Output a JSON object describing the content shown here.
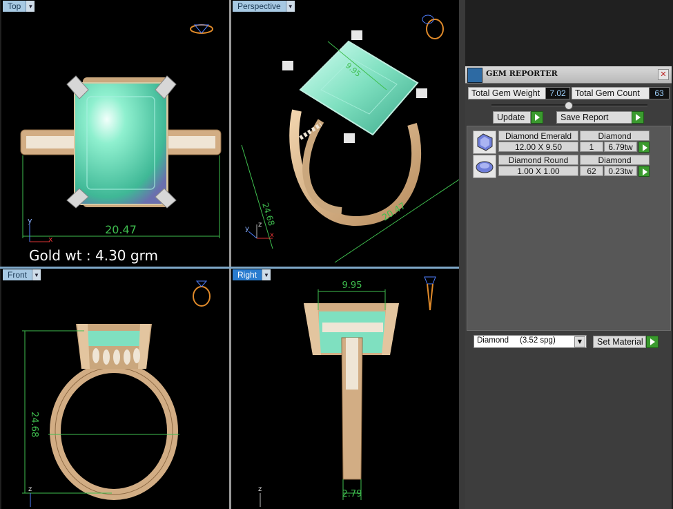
{
  "viewports": {
    "top": {
      "label": "Top",
      "dimension": "20.47",
      "axis_y": "y",
      "axis_x": "x"
    },
    "perspective": {
      "label": "Perspective",
      "dim_width": "20.47",
      "dim_height": "24.68",
      "dim_small": "9.95",
      "axis_y": "y",
      "axis_z": "z",
      "axis_x": "x"
    },
    "front": {
      "label": "Front",
      "dim_height": "24.68",
      "axis_z": "z"
    },
    "right": {
      "label": "Right",
      "dim_top": "9.95",
      "dim_bottom": "2.79",
      "axis_z": "z"
    }
  },
  "gold_weight": "Gold wt : 4.30 grm",
  "gem_reporter": {
    "title": "GEM REPORTER",
    "total_weight_label": "Total Gem Weight",
    "total_weight_value": "7.02",
    "total_count_label": "Total Gem Count",
    "total_count_value": "63",
    "update_label": "Update",
    "save_report_label": "Save Report",
    "gems": [
      {
        "name": "Diamond Emerald",
        "material": "Diamond",
        "size": "12.00 X 9.50",
        "count": "1",
        "weight": "6.79tw"
      },
      {
        "name": "Diamond Round",
        "material": "Diamond",
        "size": "1.00 X 1.00",
        "count": "62",
        "weight": "0.23tw"
      }
    ],
    "material_select": "Diamond     (3.52 spg)",
    "set_material_label": "Set Material"
  },
  "colors": {
    "gem": "#7fe0c0",
    "gold": "#d9b48a",
    "dimension": "#3fbf4f"
  }
}
